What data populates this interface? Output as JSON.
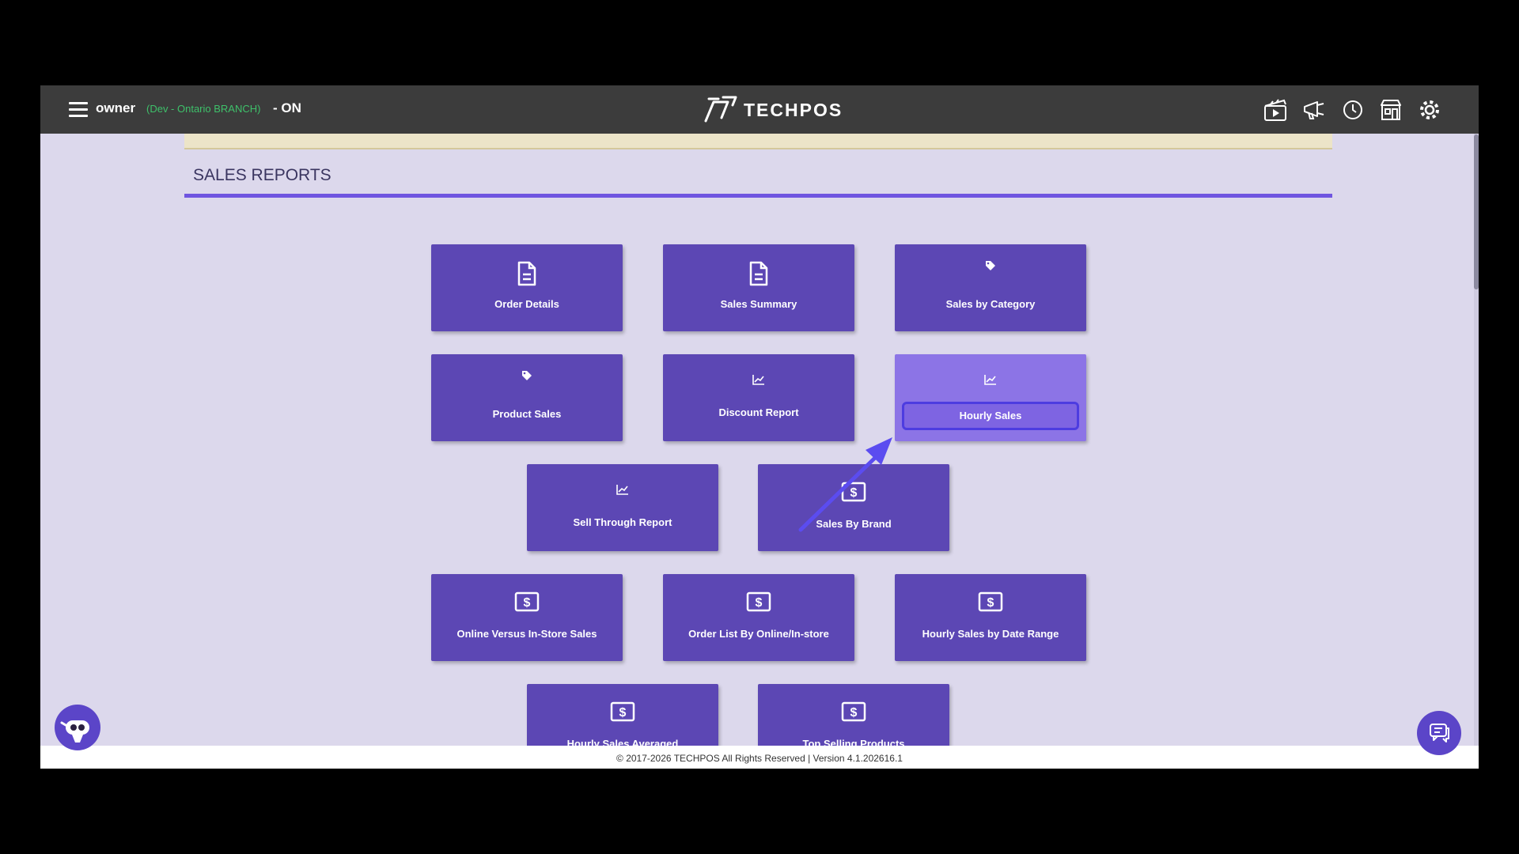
{
  "header": {
    "user": "owner",
    "branch": "(Dev - Ontario BRANCH)",
    "status": "- ON",
    "logo_text": "TECHPOS",
    "icons": [
      "clapperboard-icon",
      "megaphone-icon",
      "clock-icon",
      "store-icon",
      "gear-icon"
    ]
  },
  "section": {
    "title": "SALES REPORTS"
  },
  "tiles": [
    {
      "label": "Order Details",
      "icon": "document-icon"
    },
    {
      "label": "Sales Summary",
      "icon": "document-icon"
    },
    {
      "label": "Sales by Category",
      "icon": "tag-icon"
    },
    {
      "label": "Product Sales",
      "icon": "tag-icon"
    },
    {
      "label": "Discount Report",
      "icon": "chart-icon"
    },
    {
      "label": "Hourly Sales",
      "icon": "chart-icon",
      "highlighted": true
    },
    {
      "label": "Sell Through Report",
      "icon": "chart-icon"
    },
    {
      "label": "Sales By Brand",
      "icon": "dollar-icon"
    },
    {
      "label": "Online Versus In-Store Sales",
      "icon": "dollar-icon"
    },
    {
      "label": "Order List By Online/In-store",
      "icon": "dollar-icon"
    },
    {
      "label": "Hourly Sales by Date Range",
      "icon": "dollar-icon"
    },
    {
      "label": "Hourly Sales Averaged",
      "icon": "dollar-icon"
    },
    {
      "label": "Top Selling Products",
      "icon": "dollar-icon"
    }
  ],
  "footer": {
    "text": "© 2017-2026 TECHPOS All Rights Reserved | Version 4.1.202616.1"
  },
  "colors": {
    "tile": "#5c47b4",
    "tile_highlight": "#8c74e6",
    "accent": "#6f55e0",
    "topbar": "#3c3c3c",
    "background": "#dcd8ec"
  }
}
